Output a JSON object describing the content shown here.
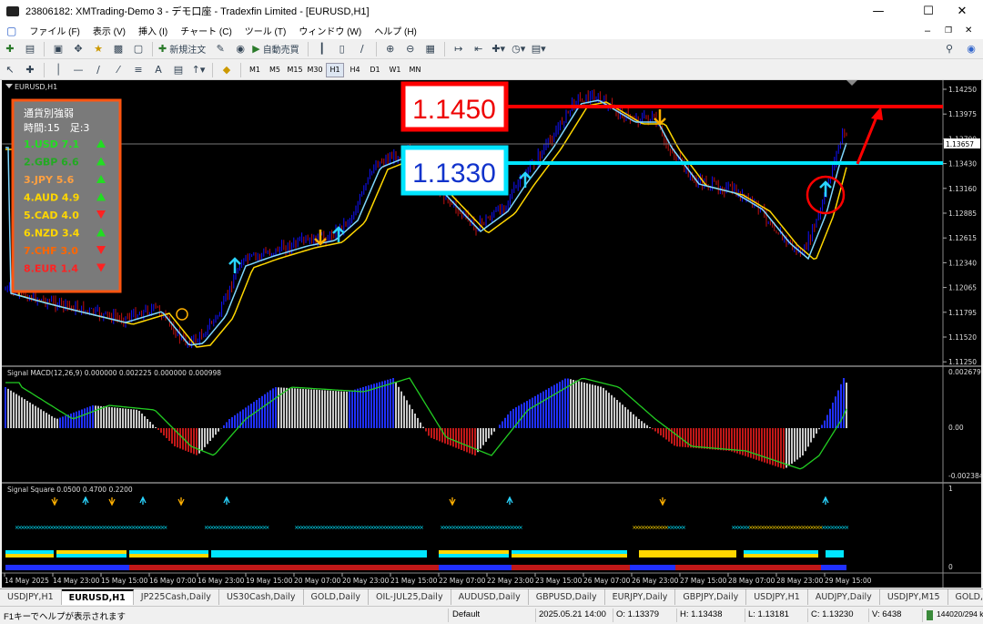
{
  "window": {
    "title": "23806182: XMTrading-Demo 3 - デモ口座 - Tradexfin Limited - [EURUSD,H1]"
  },
  "menu": [
    "ファイル (F)",
    "表示 (V)",
    "挿入 (I)",
    "チャート (C)",
    "ツール (T)",
    "ウィンドウ (W)",
    "ヘルプ (H)"
  ],
  "toolbar": {
    "new_order": "新規注文",
    "auto_trade": "自動売買",
    "timeframes": [
      "M1",
      "M5",
      "M15",
      "M30",
      "H1",
      "H4",
      "D1",
      "W1",
      "MN"
    ],
    "active_timeframe": "H1"
  },
  "chart": {
    "symbol_label": "EURUSD,H1",
    "price_ticks": [
      "1.14250",
      "1.13975",
      "1.13700",
      "1.13430",
      "1.13160",
      "1.12885",
      "1.12615",
      "1.12340",
      "1.12065",
      "1.11795",
      "1.11520",
      "1.11250"
    ],
    "current_price": "1.13657",
    "level_high": {
      "label": "1.1450",
      "color": "#ff0000"
    },
    "level_low": {
      "label": "1.1330",
      "color": "#00e5ff"
    },
    "strength_panel": {
      "title": "通貨別強弱",
      "subtitle": "時間:15　足:3",
      "items": [
        {
          "text": "1.USD 7.1",
          "color": "#22dd22",
          "dir": "up"
        },
        {
          "text": "2.GBP 6.6",
          "color": "#22aa22",
          "dir": "up"
        },
        {
          "text": "3.JPY  5.6",
          "color": "#ffa040",
          "dir": "up"
        },
        {
          "text": "4.AUD 4.9",
          "color": "#ffd700",
          "dir": "up"
        },
        {
          "text": "5.CAD 4.0",
          "color": "#ffd700",
          "dir": "down"
        },
        {
          "text": "6.NZD  3.4",
          "color": "#ffd700",
          "dir": "up"
        },
        {
          "text": "7.CHF 3.0",
          "color": "#ff6600",
          "dir": "down"
        },
        {
          "text": "8.EUR 1.4",
          "color": "#ff2222",
          "dir": "down"
        }
      ]
    }
  },
  "macd": {
    "label": "Signal MACD(12,26,9) 0.000000 0.002225 0.000000 0.000998",
    "ticks": [
      "0.002679",
      "0.00",
      "-0.002384"
    ]
  },
  "square": {
    "label": "Signal Square 0.0500 0.4700 0.2200",
    "ticks": [
      "1",
      "0"
    ]
  },
  "time_axis": [
    "14 May 2025",
    "14 May 23:00",
    "15 May 15:00",
    "16 May 07:00",
    "16 May 23:00",
    "19 May 15:00",
    "20 May 07:00",
    "20 May 23:00",
    "21 May 15:00",
    "22 May 07:00",
    "22 May 23:00",
    "23 May 15:00",
    "26 May 07:00",
    "26 May 23:00",
    "27 May 15:00",
    "28 May 07:00",
    "28 May 23:00",
    "29 May 15:00"
  ],
  "tabs": [
    "USDJPY,H1",
    "EURUSD,H1",
    "JP225Cash,Daily",
    "US30Cash,Daily",
    "GOLD,Daily",
    "OIL-JUL25,Daily",
    "AUDUSD,Daily",
    "GBPUSD,Daily",
    "EURJPY,Daily",
    "GBPJPY,Daily",
    "USDJPY,H1",
    "AUDJPY,Daily",
    "USDJPY,M15",
    "GOLD,H1"
  ],
  "active_tab": 1,
  "status": {
    "help": "F1キーでヘルプが表示されます",
    "profile": "Default",
    "datetime": "2025.05.21 14:00",
    "open": "O: 1.13379",
    "high": "H: 1.13438",
    "low": "L: 1.13181",
    "close": "C: 1.13230",
    "volume": "V: 6438",
    "traffic": "144020/294 kb"
  }
}
